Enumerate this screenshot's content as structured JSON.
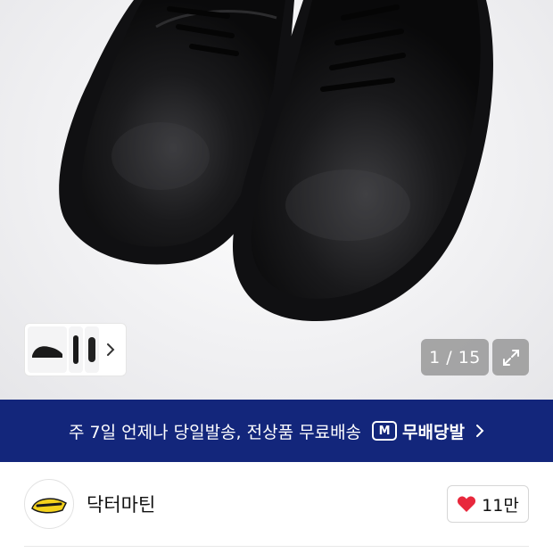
{
  "gallery": {
    "counter": "1 / 15",
    "expand_icon": "expand-icon",
    "thumb_arrow_icon": "chevron-right-icon"
  },
  "banner": {
    "text": "주 7일 언제나 당일발송, 전상품 무료배송",
    "badge_icon_text": "M",
    "badge_label": "무배당발",
    "arrow_icon": "chevron-right-icon",
    "background": "#13267b"
  },
  "brand": {
    "name": "닥터마틴",
    "logo_icon": "dr-martens-logo",
    "like_count": "11만",
    "like_icon": "heart-icon",
    "like_color": "#e8283c"
  }
}
